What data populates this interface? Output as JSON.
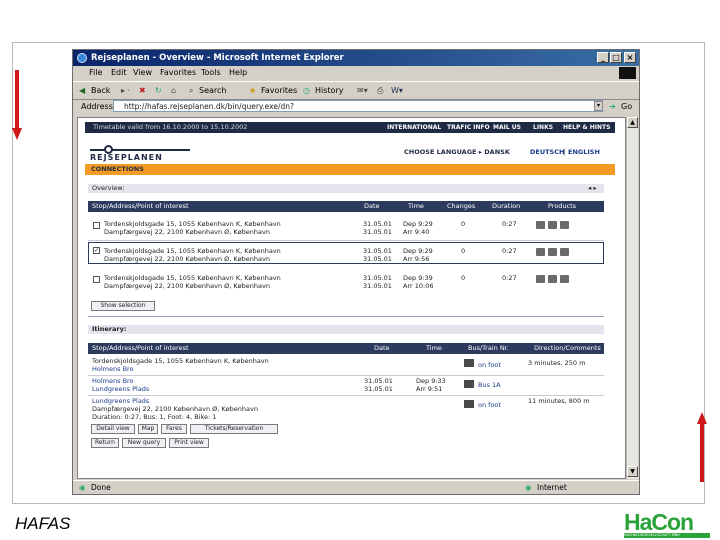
{
  "window": {
    "title": "Rejseplanen - Overview - Microsoft Internet Explorer",
    "controls": {
      "minimize": "_",
      "maximize": "□",
      "close": "×"
    }
  },
  "menu": [
    "File",
    "Edit",
    "View",
    "Favorites",
    "Tools",
    "Help"
  ],
  "toolbar": {
    "back": "Back",
    "search": "Search",
    "favorites": "Favorites",
    "history": "History"
  },
  "address": {
    "label": "Address",
    "url": "http://hafas.rejseplanen.dk/bin/query.exe/dn?",
    "go": "Go"
  },
  "status": {
    "left": "Done",
    "right": "Internet"
  },
  "site": {
    "timetable": "Timetable valid from 16.10.2000 to 15.10.2002",
    "nav": [
      "INTERNATIONAL",
      "TRAFIC INFO",
      "MAIL US",
      "LINKS",
      "HELP & HINTS"
    ],
    "logo": "REJSEPLANEN",
    "choose_language": "CHOOSE LANGUAGE ▸ DANSK",
    "lang_de": "DEUTSCH",
    "lang_sep": "|",
    "lang_en": "ENGLISH",
    "section": "CONNECTIONS"
  },
  "overview": {
    "title": "Overview:",
    "nav": "◂ ▸",
    "columns": [
      "Stop/Address/Point of interest",
      "Date",
      "Time",
      "Changes",
      "Duration",
      "Products"
    ],
    "rows": [
      {
        "checked": false,
        "from": "Tordenskjoldsgade 15, 1055 København K, København",
        "to": "Dampfærgevej 22, 2100 København Ø, København",
        "date1": "31.05.01",
        "date2": "31.05.01",
        "time1": "Dep 9:29",
        "time2": "Arr 9:40",
        "changes": "0",
        "duration": "0:27"
      },
      {
        "checked": true,
        "from": "Tordenskjoldsgade 15, 1055 København K, København",
        "to": "Dampfærgevej 22, 2100 København Ø, København",
        "date1": "31.05.01",
        "date2": "31.05.01",
        "time1": "Dep 9:29",
        "time2": "Arr 9:56",
        "changes": "0",
        "duration": "0:27"
      },
      {
        "checked": false,
        "from": "Tordenskjoldsgade 15, 1055 København K, København",
        "to": "Dampfærgevej 22, 2100 København Ø, København",
        "date1": "31.05.01",
        "date2": "31.05.01",
        "time1": "Dep 9:39",
        "time2": "Arr 10:06",
        "changes": "0",
        "duration": "0:27"
      }
    ],
    "show_selection": "Show selection"
  },
  "itinerary": {
    "title": "Itinerary:",
    "columns": [
      "Stop/Address/Point of interest",
      "Date",
      "Time",
      "Bus/Train Nr.",
      "Direction/Comments"
    ],
    "rows": [
      {
        "place": "Tordenskjoldsgade 15, 1055 København K, København",
        "place2": "Holmens Bro",
        "date": "",
        "time": "",
        "mode": "on foot",
        "comment": "3 minutes, 250 m"
      },
      {
        "place": "Holmens Bro",
        "place2": "Lundgreens Plads",
        "date": "31.05.01",
        "date2": "31.05.01",
        "time": "Dep 9:33",
        "time2": "Arr 9:51",
        "mode": "Bus 1A",
        "comment": ""
      },
      {
        "place": "Lundgreens Plads",
        "place2": "Dampfærgevej 22, 2100 København Ø, København",
        "place3": "Duration: 0:27, Bus: 1, Foot: 4, Bike: 1",
        "date": "",
        "time": "",
        "mode": "on foot",
        "comment": "11 minutes, 800 m"
      }
    ],
    "buttons": [
      "Detail view",
      "Map",
      "Fares",
      "Tickets/Reservation",
      "Return",
      "New query",
      "Print view"
    ]
  },
  "footer": {
    "label": "HAFAS",
    "logo": "HaCon",
    "logo_sub": "INGENIEURGESELLSCHAFT MBH"
  },
  "colors": {
    "accent": "#f39b24",
    "navy": "#2c3a5e",
    "hacon_green": "#2aa33a",
    "arrow_red": "#d01818"
  }
}
